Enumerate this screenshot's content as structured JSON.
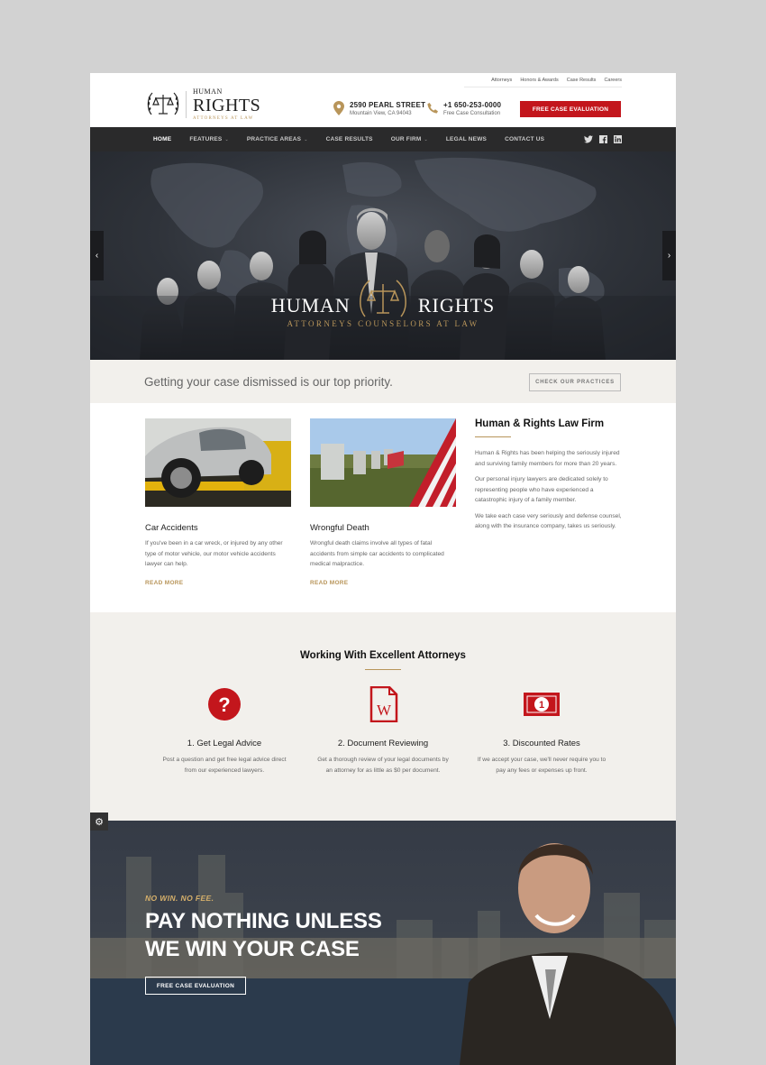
{
  "top_links": [
    "Attorneys",
    "Honors & Awards",
    "Case Results",
    "Careers"
  ],
  "logo": {
    "small": "HUMAN",
    "big": "RIGHTS",
    "tagline": "ATTORNEYS AT LAW"
  },
  "contact": {
    "address": {
      "line1": "2590 PEARL STREET",
      "line2": "Mountain View, CA 94043"
    },
    "phone": {
      "line1": "+1 650-253-0000",
      "line2": "Free Case Consultation"
    }
  },
  "cta_button": "FREE CASE EVALUATION",
  "nav": {
    "items": [
      {
        "label": "HOME",
        "caret": false
      },
      {
        "label": "FEATURES",
        "caret": true
      },
      {
        "label": "PRACTICE AREAS",
        "caret": true
      },
      {
        "label": "CASE RESULTS",
        "caret": false
      },
      {
        "label": "OUR FIRM",
        "caret": true
      },
      {
        "label": "LEGAL NEWS",
        "caret": false
      },
      {
        "label": "CONTACT US",
        "caret": false
      }
    ],
    "caret_glyph": "⌄",
    "social_icons": [
      "twitter-icon",
      "facebook-icon",
      "linkedin-icon"
    ]
  },
  "hero": {
    "title_left": "HUMAN",
    "title_right": "RIGHTS",
    "subtitle": "ATTORNEYS COUNSELORS AT LAW",
    "prev_glyph": "‹",
    "next_glyph": "›"
  },
  "strip": {
    "text": "Getting your case dismissed is our top priority.",
    "button": "CHECK OUR PRACTICES"
  },
  "practices": [
    {
      "title": "Car Accidents",
      "text": "If you've been in a car wreck, or injured by any other type of motor vehicle, our motor vehicle accidents lawyer can help.",
      "more": "READ MORE"
    },
    {
      "title": "Wrongful Death",
      "text": "Wrongful death claims involve all types of fatal accidents from simple car accidents to complicated medical malpractice.",
      "more": "READ MORE"
    }
  ],
  "firm": {
    "title": "Human & Rights Law Firm",
    "paragraphs": [
      "Human & Rights has been helping the seriously injured and surviving family members for more than 20 years.",
      "Our personal injury lawyers are dedicated solely to representing people who have experienced a catastrophic injury of a family member.",
      "We take each case very seriously and defense counsel, along with the insurance company, takes us seriously."
    ]
  },
  "section2": {
    "title": "Working With Excellent Attorneys",
    "features": [
      {
        "title": "1. Get Legal Advice",
        "text": "Post a question and get free legal advice direct from our experienced lawyers.",
        "icon": "question-circle-icon"
      },
      {
        "title": "2. Document Reviewing",
        "text": "Get a thorough review of your legal documents by an attorney for as little as $0 per document.",
        "icon": "document-icon"
      },
      {
        "title": "3. Discounted Rates",
        "text": "If we accept your case, we'll never require you to pay any fees or expenses up front.",
        "icon": "money-icon"
      }
    ]
  },
  "cta": {
    "kicker": "NO WIN. NO FEE.",
    "line1": "PAY NOTHING UNLESS",
    "line2": "WE WIN YOUR CASE",
    "button": "FREE CASE EVALUATION"
  },
  "colors": {
    "accent_red": "#c3161c",
    "gold": "#b8955a",
    "nav_bg": "#2a2a2b",
    "light_bg": "#f2f0ec"
  }
}
